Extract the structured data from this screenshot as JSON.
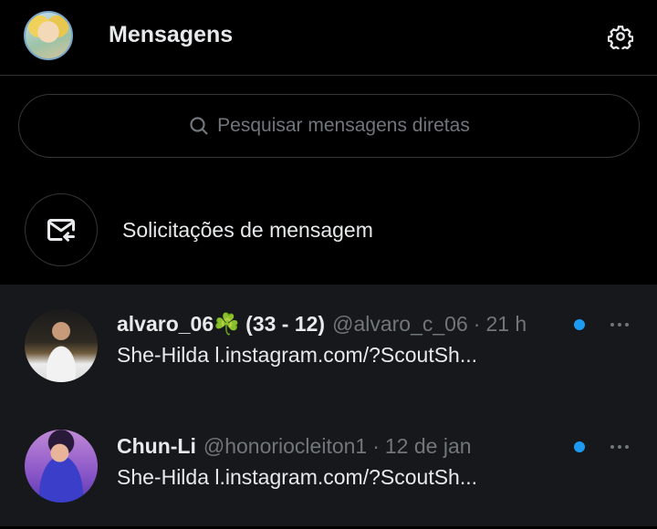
{
  "header": {
    "title": "Mensagens",
    "avatar_icon": "user-avatar",
    "settings_icon": "gear-icon"
  },
  "search": {
    "placeholder": "Pesquisar mensagens diretas",
    "icon": "search-icon"
  },
  "requests": {
    "label": "Solicitações de mensagem",
    "icon": "envelope-incoming-icon"
  },
  "conversations": [
    {
      "name": "alvaro_06☘️ (33 - 12)",
      "handle": "@alvaro_c_06",
      "separator": "·",
      "time": "21 h",
      "preview": "She-Hilda l.instagram.com/?ScoutSh...",
      "unread": true
    },
    {
      "name": "Chun-Li",
      "handle": "@honoriocleiton1",
      "separator": "·",
      "time": "12 de jan",
      "preview": "She-Hilda l.instagram.com/?ScoutSh...",
      "unread": true
    }
  ],
  "colors": {
    "background": "#000000",
    "list_background": "#16181c",
    "accent": "#1d9bf0",
    "text_primary": "#e7e9ea",
    "text_secondary": "#71767b"
  }
}
